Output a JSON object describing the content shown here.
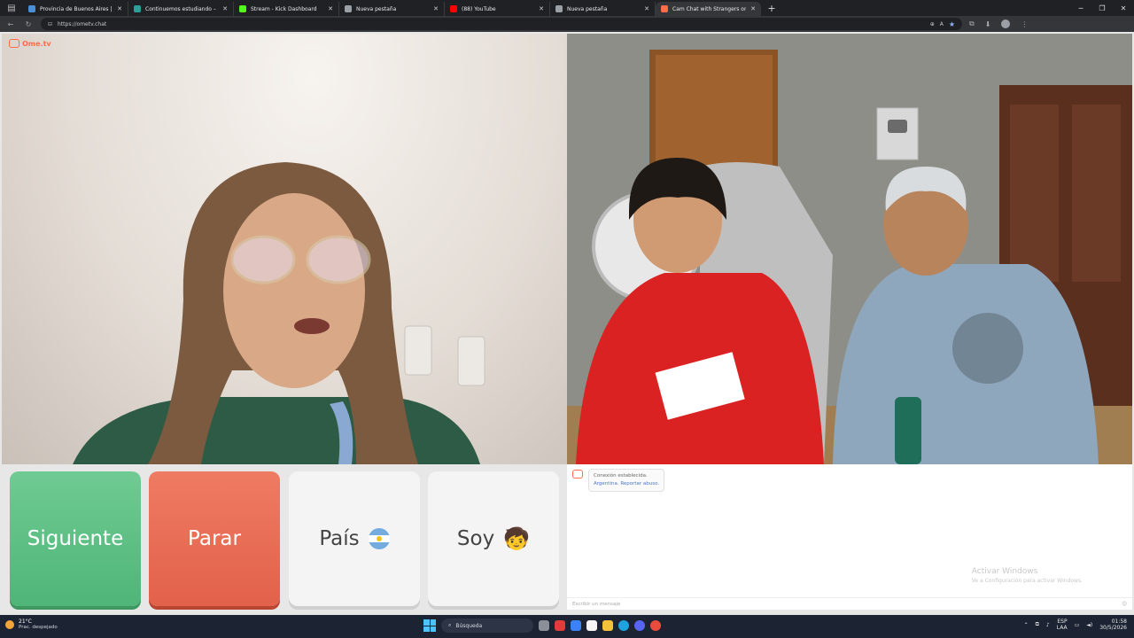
{
  "browser": {
    "tabs": [
      {
        "title": "Provincia de Buenos Aires |",
        "favicon_color": "#4a90d9",
        "active": false
      },
      {
        "title": "Continuemos estudiando – Plata",
        "favicon_color": "#2aa198",
        "active": false
      },
      {
        "title": "Stream - Kick Dashboard",
        "favicon_color": "#53fc18",
        "active": false
      },
      {
        "title": "Nueva pestaña",
        "favicon_color": "#9aa0a6",
        "active": false
      },
      {
        "title": "(88) YouTube",
        "favicon_color": "#ff0000",
        "active": false
      },
      {
        "title": "Nueva pestaña",
        "favicon_color": "#9aa0a6",
        "active": false
      },
      {
        "title": "Cam Chat with Strangers on",
        "favicon_color": "#ff6c4a",
        "active": true
      }
    ],
    "url": "https://ometv.chat"
  },
  "site": {
    "logo": "Ome.tv",
    "buttons": {
      "next": "Siguiente",
      "stop": "Parar",
      "country": "País",
      "gender": "Soy",
      "gender_emoji": "🧒"
    },
    "country_flag_colors": [
      "#74acdf",
      "#ffffff",
      "#74acdf"
    ],
    "colors": {
      "next": "#5cbf84",
      "stop": "#e86e57",
      "neutral": "#f4f4f4"
    }
  },
  "chat": {
    "message_line1": "Conexión establecida.",
    "message_line2": "Argentina. Reportar abuso.",
    "input_placeholder": "Escribir un mensaje",
    "watermark_title": "Activar Windows",
    "watermark_sub": "Ve a Configuración para activar Windows."
  },
  "taskbar": {
    "weather_temp": "21°C",
    "weather_desc": "Prac. despejado",
    "search": "Búsqueda",
    "lang_top": "ESP",
    "lang_bottom": "LAA",
    "time": "01:58",
    "date": "30/5/2026"
  }
}
